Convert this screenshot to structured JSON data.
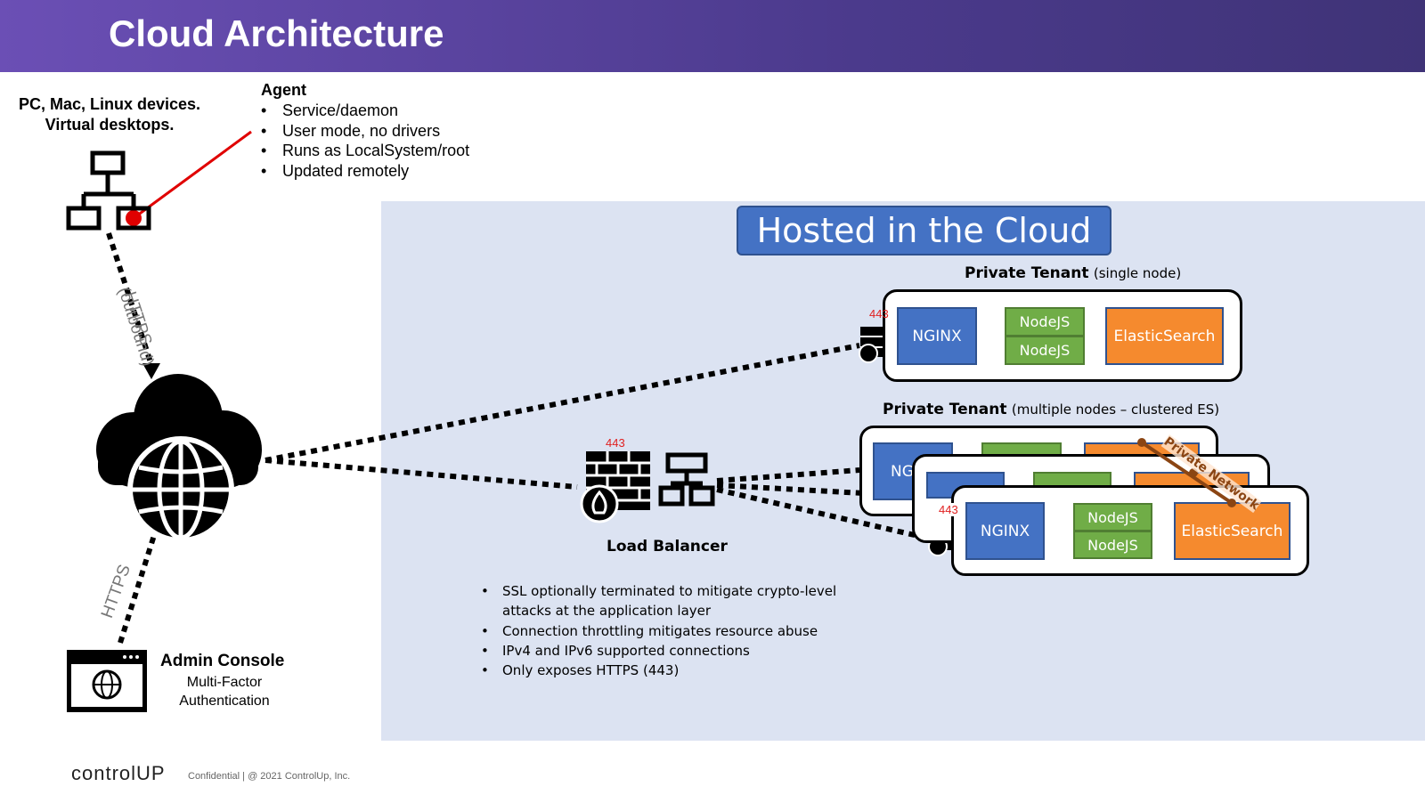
{
  "header": {
    "title": "Cloud Architecture"
  },
  "devices": {
    "line1": "PC, Mac, Linux devices.",
    "line2": "Virtual desktops."
  },
  "agent": {
    "title": "Agent",
    "bullets": [
      "Service/daemon",
      "User mode, no drivers",
      "Runs as LocalSystem/root",
      "Updated remotely"
    ]
  },
  "links": {
    "devices_to_cloud": "HTTPS",
    "devices_to_cloud_sub": "(outbound)",
    "admin_to_cloud": "HTTPS"
  },
  "admin": {
    "title": "Admin Console",
    "sub1": "Multi-Factor",
    "sub2": "Authentication"
  },
  "cloud": {
    "title": "Hosted in the Cloud"
  },
  "tenant_single": {
    "label": "Private Tenant",
    "qualifier": "(single node)",
    "port": "443",
    "nginx": "NGINX",
    "node1": "NodeJS",
    "node2": "NodeJS",
    "es": "ElasticSearch"
  },
  "tenant_multi": {
    "label": "Private Tenant",
    "qualifier": "(multiple nodes – clustered ES)",
    "port": "443",
    "nginx": "NGINX",
    "nginx_partial": "NG",
    "node1": "NodeJS",
    "node2": "NodeJS",
    "es": "ElasticSearch",
    "private_network": "Private Network"
  },
  "load_balancer": {
    "label": "Load Balancer",
    "port": "443",
    "bullets": [
      "SSL optionally terminated to mitigate crypto-level attacks at the application layer",
      "Connection throttling mitigates resource abuse",
      "IPv4 and IPv6 supported connections",
      "Only exposes HTTPS (443)"
    ]
  },
  "footer": {
    "logo": "controlUP",
    "text": "Confidential | @ 2021 ControlUp, Inc."
  },
  "colors": {
    "header": "#5a43a0",
    "panel": "#dce3f2",
    "nginx": "#4472c4",
    "nodejs": "#70ad47",
    "elasticsearch": "#f58a2e",
    "agent_line": "#e00000",
    "port": "#e02020",
    "private_network": "#8b4513"
  }
}
